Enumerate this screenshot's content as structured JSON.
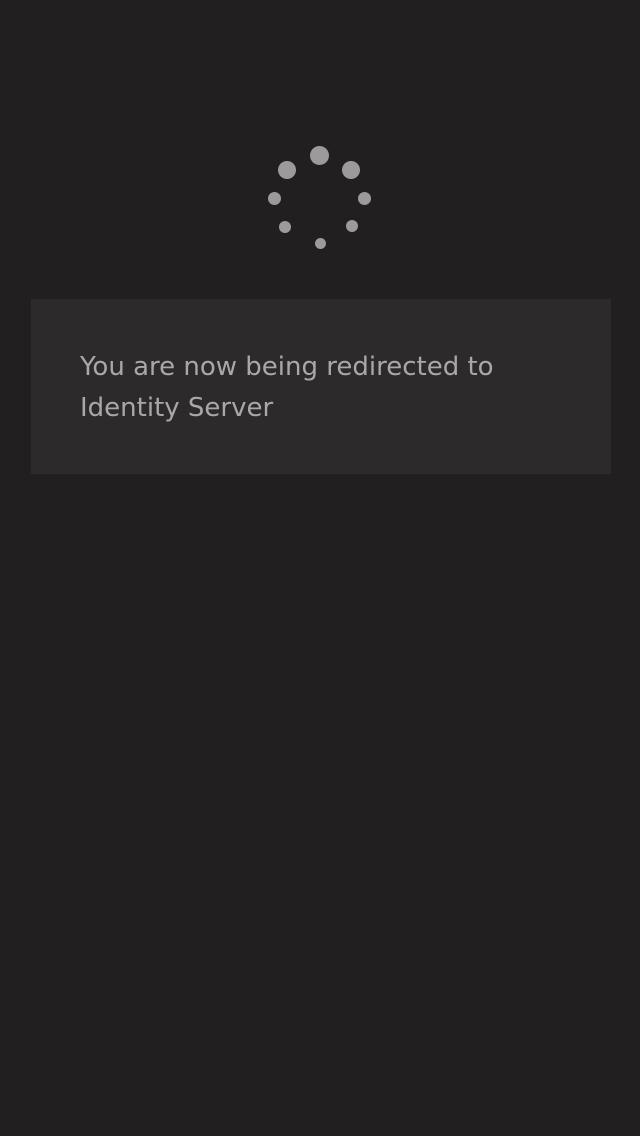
{
  "loading_indicator": {
    "icon": "loading-spinner-icon",
    "color": "#9c9a9b"
  },
  "message": {
    "text": "You are now being redirected to Identity Server"
  },
  "colors": {
    "background": "#211f20",
    "panel": "#2c2a2b",
    "text": "#a9a7a8"
  }
}
